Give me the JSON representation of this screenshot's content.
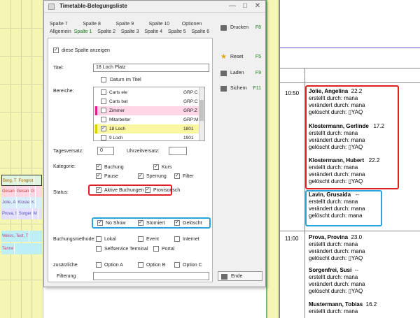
{
  "background": {
    "rows": [
      [
        "Berg, T",
        "Fongrot"
      ],
      [
        "Gesan",
        "Gesan",
        "G"
      ],
      [
        "Jolie, A",
        "Kloste",
        "K"
      ],
      [
        "Prova, I",
        "Sorger",
        "M"
      ],
      [
        "Weiss, Test, T"
      ],
      [
        "Tanne"
      ]
    ]
  },
  "dialog": {
    "title": "Timetable-Belegungsliste",
    "tabs_row1": [
      "Spalte 7",
      "Spalte 8",
      "Spalte 9",
      "Spalte 10",
      "Optionen"
    ],
    "tabs_row2": [
      "Allgemein",
      "Spalte 1",
      "Spalte 2",
      "Spalte 3",
      "Spalte 4",
      "Spalte 5",
      "Spalte 6"
    ],
    "show_column_label": "diese Spalte anzeigen",
    "titel_label": "Titel:",
    "titel_value": "18 Loch Platz",
    "datum_label": "Datum im Titel",
    "bereiche_label": "Bereiche:",
    "bereiche": [
      {
        "name": "Carts ele",
        "code": "GRP:C"
      },
      {
        "name": "Carts bat",
        "code": "GRP:C"
      },
      {
        "name": "Zimmer",
        "code": "GRP:Z"
      },
      {
        "name": "Mitarbeiter",
        "code": "GRP:M"
      },
      {
        "name": "18 Loch",
        "code": "1801"
      },
      {
        "name": "9 Loch",
        "code": "1901"
      }
    ],
    "tagesversatz_label": "Tagesversatz:",
    "tagesversatz_value": "0",
    "uhrzeitversatz_label": "Uhrzeitversatz:",
    "uhrzeitversatz_value": "",
    "kategorie_label": "Kategorie:",
    "kategorie": [
      "Buchung",
      "Kurs",
      "Pause",
      "Sperrung",
      "Filter"
    ],
    "status_label": "Status:",
    "status": [
      "Aktive Buchungen",
      "Provisorisch",
      "No Show",
      "Storniert",
      "Gelöscht"
    ],
    "buchungsmethode_label": "Buchungsmethode:",
    "buchungsmethode": [
      "Lokal",
      "Event",
      "Internet",
      "Selfservice Terminal",
      "Portal"
    ],
    "zusaetzliche_label": "zusätzliche",
    "options": [
      "Option A",
      "Option B",
      "Option C"
    ],
    "filterung_label": "Filterung",
    "filterung_value": "",
    "side_buttons": [
      {
        "label": "Drucken",
        "key": "F8",
        "icon": "printer-icon"
      },
      {
        "label": "Reset",
        "key": "F5",
        "icon": "star-icon"
      },
      {
        "label": "Laden",
        "key": "F9",
        "icon": "folder-icon"
      },
      {
        "label": "Sichern",
        "key": "F11",
        "icon": "save-icon"
      },
      {
        "label": "Ende",
        "key": "",
        "icon": "exit-icon"
      }
    ]
  },
  "report": {
    "times": [
      "10:50",
      "11:00"
    ],
    "entries": [
      {
        "name": "Jolie, Angelina",
        "count": "22.2",
        "lines": [
          "erstellt durch: mana",
          "verändert durch: mana",
          "gelöscht durch: ▯YAQ"
        ]
      },
      {
        "name": "Klostermann, Gerlinde",
        "count": "17.2",
        "lines": [
          "erstellt durch: mana",
          "verändert durch: mana",
          "gelöscht durch: ▯YAQ"
        ]
      },
      {
        "name": "Klostermann, Hubert",
        "count": "22.2",
        "lines": [
          "erstellt durch: mana",
          "verändert durch: mana",
          "gelöscht durch: ▯YAQ"
        ]
      },
      {
        "name": "Lavin, Grusaida",
        "count": "--",
        "lines": [
          "erstellt durch: mana",
          "verändert durch: mana",
          "gelöscht durch: mana"
        ]
      },
      {
        "name": "Prova, Provina",
        "count": "23.0",
        "lines": [
          "erstellt durch: mana",
          "verändert durch: mana",
          "gelöscht durch: ▯YAQ"
        ]
      },
      {
        "name": "Sorgenfrei, Susi",
        "count": "--",
        "lines": [
          "erstellt durch: mana",
          "verändert durch: mana",
          "gelöscht durch: ▯YAQ"
        ]
      },
      {
        "name": "Mustermann, Tobias",
        "count": "16.2",
        "lines": [
          "erstellt durch: mana"
        ]
      }
    ]
  }
}
